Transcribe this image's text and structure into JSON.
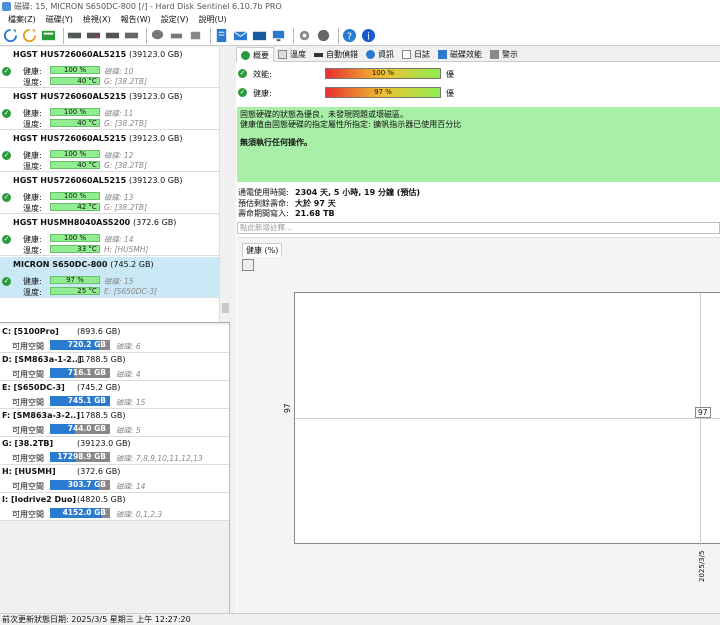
{
  "window": {
    "title": "磁碟: 15, MICRON    S650DC-800 [/]  -  Hard Disk Sentinel 6.10.7b PRO"
  },
  "menu": [
    "檔案(Z)",
    "磁碟(Y)",
    "檢視(X)",
    "報告(W)",
    "設定(V)",
    "說明(U)"
  ],
  "disks": [
    {
      "model": "HGST    HUS726060AL5215",
      "size": "(39123.0 GB)",
      "health_label": "健康:",
      "health": "100 %",
      "health_pct": 100,
      "temp_label": "溫度:",
      "temp": "40 °C",
      "temp_pct": 40,
      "disk_no": "磁碟: 10",
      "volume": "G: [38.2TB]"
    },
    {
      "model": "HGST    HUS726060AL5215",
      "size": "(39123.0 GB)",
      "health_label": "健康:",
      "health": "100 %",
      "health_pct": 100,
      "temp_label": "溫度:",
      "temp": "40 °C",
      "temp_pct": 40,
      "disk_no": "磁碟: 11",
      "volume": "G: [38.2TB]"
    },
    {
      "model": "HGST    HUS726060AL5215",
      "size": "(39123.0 GB)",
      "health_label": "健康:",
      "health": "100 %",
      "health_pct": 100,
      "temp_label": "溫度:",
      "temp": "40 °C",
      "temp_pct": 40,
      "disk_no": "磁碟: 12",
      "volume": "G: [38.2TB]"
    },
    {
      "model": "HGST    HUS726060AL5215",
      "size": "(39123.0 GB)",
      "health_label": "健康:",
      "health": "100 %",
      "health_pct": 100,
      "temp_label": "溫度:",
      "temp": "42 °C",
      "temp_pct": 42,
      "disk_no": "磁碟: 13",
      "volume": "G: [38.2TB]"
    },
    {
      "model": "HGST    HUSMH8040ASS200",
      "size": "(372.6 GB)",
      "health_label": "健康:",
      "health": "100 %",
      "health_pct": 100,
      "temp_label": "溫度:",
      "temp": "33 °C",
      "temp_pct": 33,
      "disk_no": "磁碟: 14",
      "volume": "H: [HUSMH]"
    },
    {
      "model": "MICRON    S650DC-800",
      "size": "(745.2 GB)",
      "health_label": "健康:",
      "health": "97 %",
      "health_pct": 97,
      "temp_label": "溫度:",
      "temp": "25 °C",
      "temp_pct": 25,
      "disk_no": "磁碟: 15",
      "volume": "E: [S650DC-3]"
    }
  ],
  "volumes": [
    {
      "name": "C: [5100Pro]",
      "size": "(893.6 GB)",
      "free_label": "可用空間",
      "free": "720.2 GB",
      "free_pct": 81,
      "disks": "磁碟: 6"
    },
    {
      "name": "D: [SM863a-1-2..]",
      "size": "(1788.5 GB)",
      "free_label": "可用空間",
      "free": "716.1 GB",
      "free_pct": 40,
      "disks": "磁碟: 4"
    },
    {
      "name": "E: [S650DC-3]",
      "size": "(745.2 GB)",
      "free_label": "可用空間",
      "free": "745.1 GB",
      "free_pct": 100,
      "disks": "磁碟: 15"
    },
    {
      "name": "F: [SM863a-3-2..]",
      "size": "(1788.5 GB)",
      "free_label": "可用空間",
      "free": "744.0 GB",
      "free_pct": 42,
      "disks": "磁碟: 5"
    },
    {
      "name": "G: [38.2TB]",
      "size": "(39123.0 GB)",
      "free_label": "可用空間",
      "free": "17298.9 GB",
      "free_pct": 44,
      "disks": "磁碟: 7,8,9,10,11,12,13"
    },
    {
      "name": "H: [HUSMH]",
      "size": "(372.6 GB)",
      "free_label": "可用空間",
      "free": "303.7 GB",
      "free_pct": 82,
      "disks": "磁碟: 14"
    },
    {
      "name": "I: [Iodrive2 Duo]",
      "size": "(4820.5 GB)",
      "free_label": "可用空間",
      "free": "4152.0 GB",
      "free_pct": 86,
      "disks": "磁碟: 0,1,2,3"
    }
  ],
  "tabs": [
    "概要",
    "溫度",
    "自動偵錯",
    "資訊",
    "日誌",
    "磁碟效能",
    "警示"
  ],
  "performance": {
    "label": "效能:",
    "value": "100 %",
    "pct": 100,
    "rating": "優"
  },
  "health": {
    "label": "健康:",
    "value": "97 %",
    "pct": 97,
    "rating": "優"
  },
  "notice": {
    "line1": "固態硬碟的狀態為優良，未發現問題或壞磁區。",
    "line2": "健康值由固態硬碟的指定屬性所指定: 擴帆指示器已使用百分比",
    "action": "無須執行任何操作。"
  },
  "stats": [
    {
      "k": "通電使用時間:",
      "v": "2304 天, 5 小時, 19 分鐘 (預估)"
    },
    {
      "k": "預估剩餘壽命:",
      "v": "大於 97 天"
    },
    {
      "k": "壽命期間寫入:",
      "v": "21.68 TB"
    }
  ],
  "note_placeholder": "點此新增註釋...",
  "chart_tab": "健康 (%)",
  "chart_data": {
    "type": "line",
    "title": "健康 (%)",
    "ylabel": "97",
    "x": [
      "2025/3/5"
    ],
    "series": [
      {
        "values": [
          97
        ]
      }
    ],
    "point_label": "97"
  },
  "status": "前次更新狀態日期: 2025/3/5 星期三 上午 12:27:20",
  "colors": {
    "health_green": "#90ee90",
    "notice_green": "#a8f0a8",
    "selected": "#cbe8f6",
    "volume_blue": "#2a7ad0"
  }
}
